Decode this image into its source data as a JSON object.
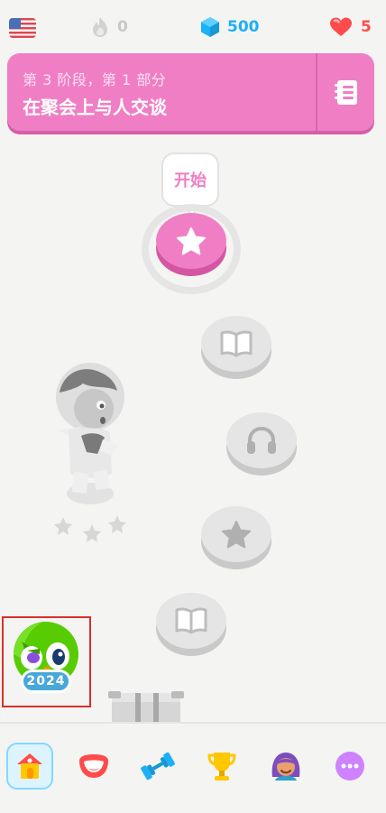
{
  "topbar": {
    "flag": "us-flag-icon",
    "streak": "0",
    "gems": "500",
    "hearts": "5"
  },
  "unit": {
    "subtitle": "第 3 阶段，第 1 部分",
    "title": "在聚会上与人交谈",
    "guide_icon": "guidebook-icon"
  },
  "path": {
    "start_label": "开始",
    "nodes": [
      {
        "type": "star",
        "state": "active"
      },
      {
        "type": "book",
        "state": "locked"
      },
      {
        "type": "headphones",
        "state": "locked"
      },
      {
        "type": "star",
        "state": "locked"
      },
      {
        "type": "book",
        "state": "locked"
      }
    ]
  },
  "year_in_review": {
    "badge": "2024"
  },
  "nav": {
    "items": [
      "home-icon",
      "speak-icon",
      "practice-icon",
      "leaderboard-icon",
      "profile-icon",
      "more-icon"
    ],
    "active": "home-icon"
  },
  "colors": {
    "accent": "#f07ec4",
    "gem": "#1cb0f6",
    "heart": "#ff4b4b",
    "locked": "#e5e5e5"
  }
}
